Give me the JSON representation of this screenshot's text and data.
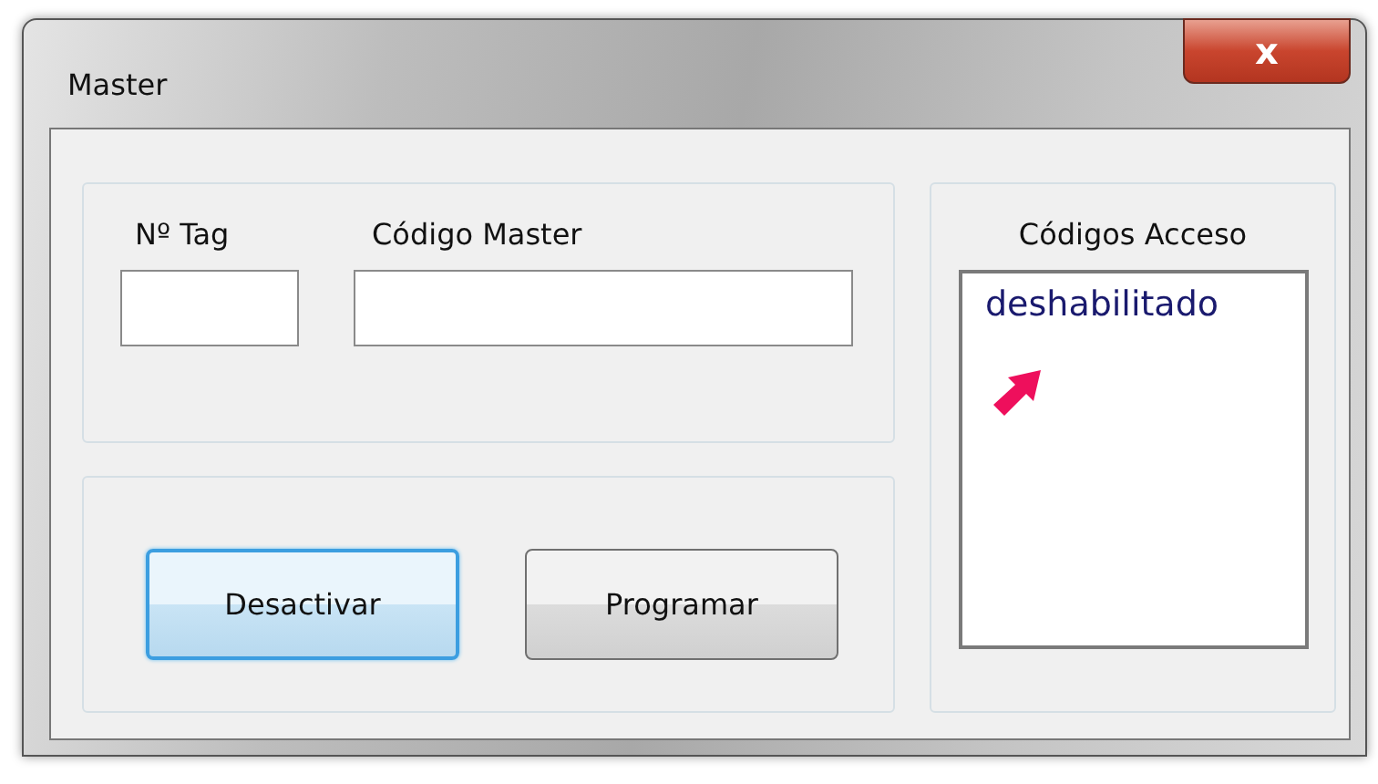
{
  "window": {
    "title": "Master",
    "close": "x"
  },
  "tag_field": {
    "label": "Nº Tag"
  },
  "code_field": {
    "label": "Código Master"
  },
  "buttons": [
    {
      "label": "Desactivar",
      "focused": true
    },
    {
      "label": "Programar",
      "focused": false
    }
  ],
  "access_codes": {
    "label": "Códigos Acceso",
    "items": [
      "deshabilitado"
    ]
  }
}
